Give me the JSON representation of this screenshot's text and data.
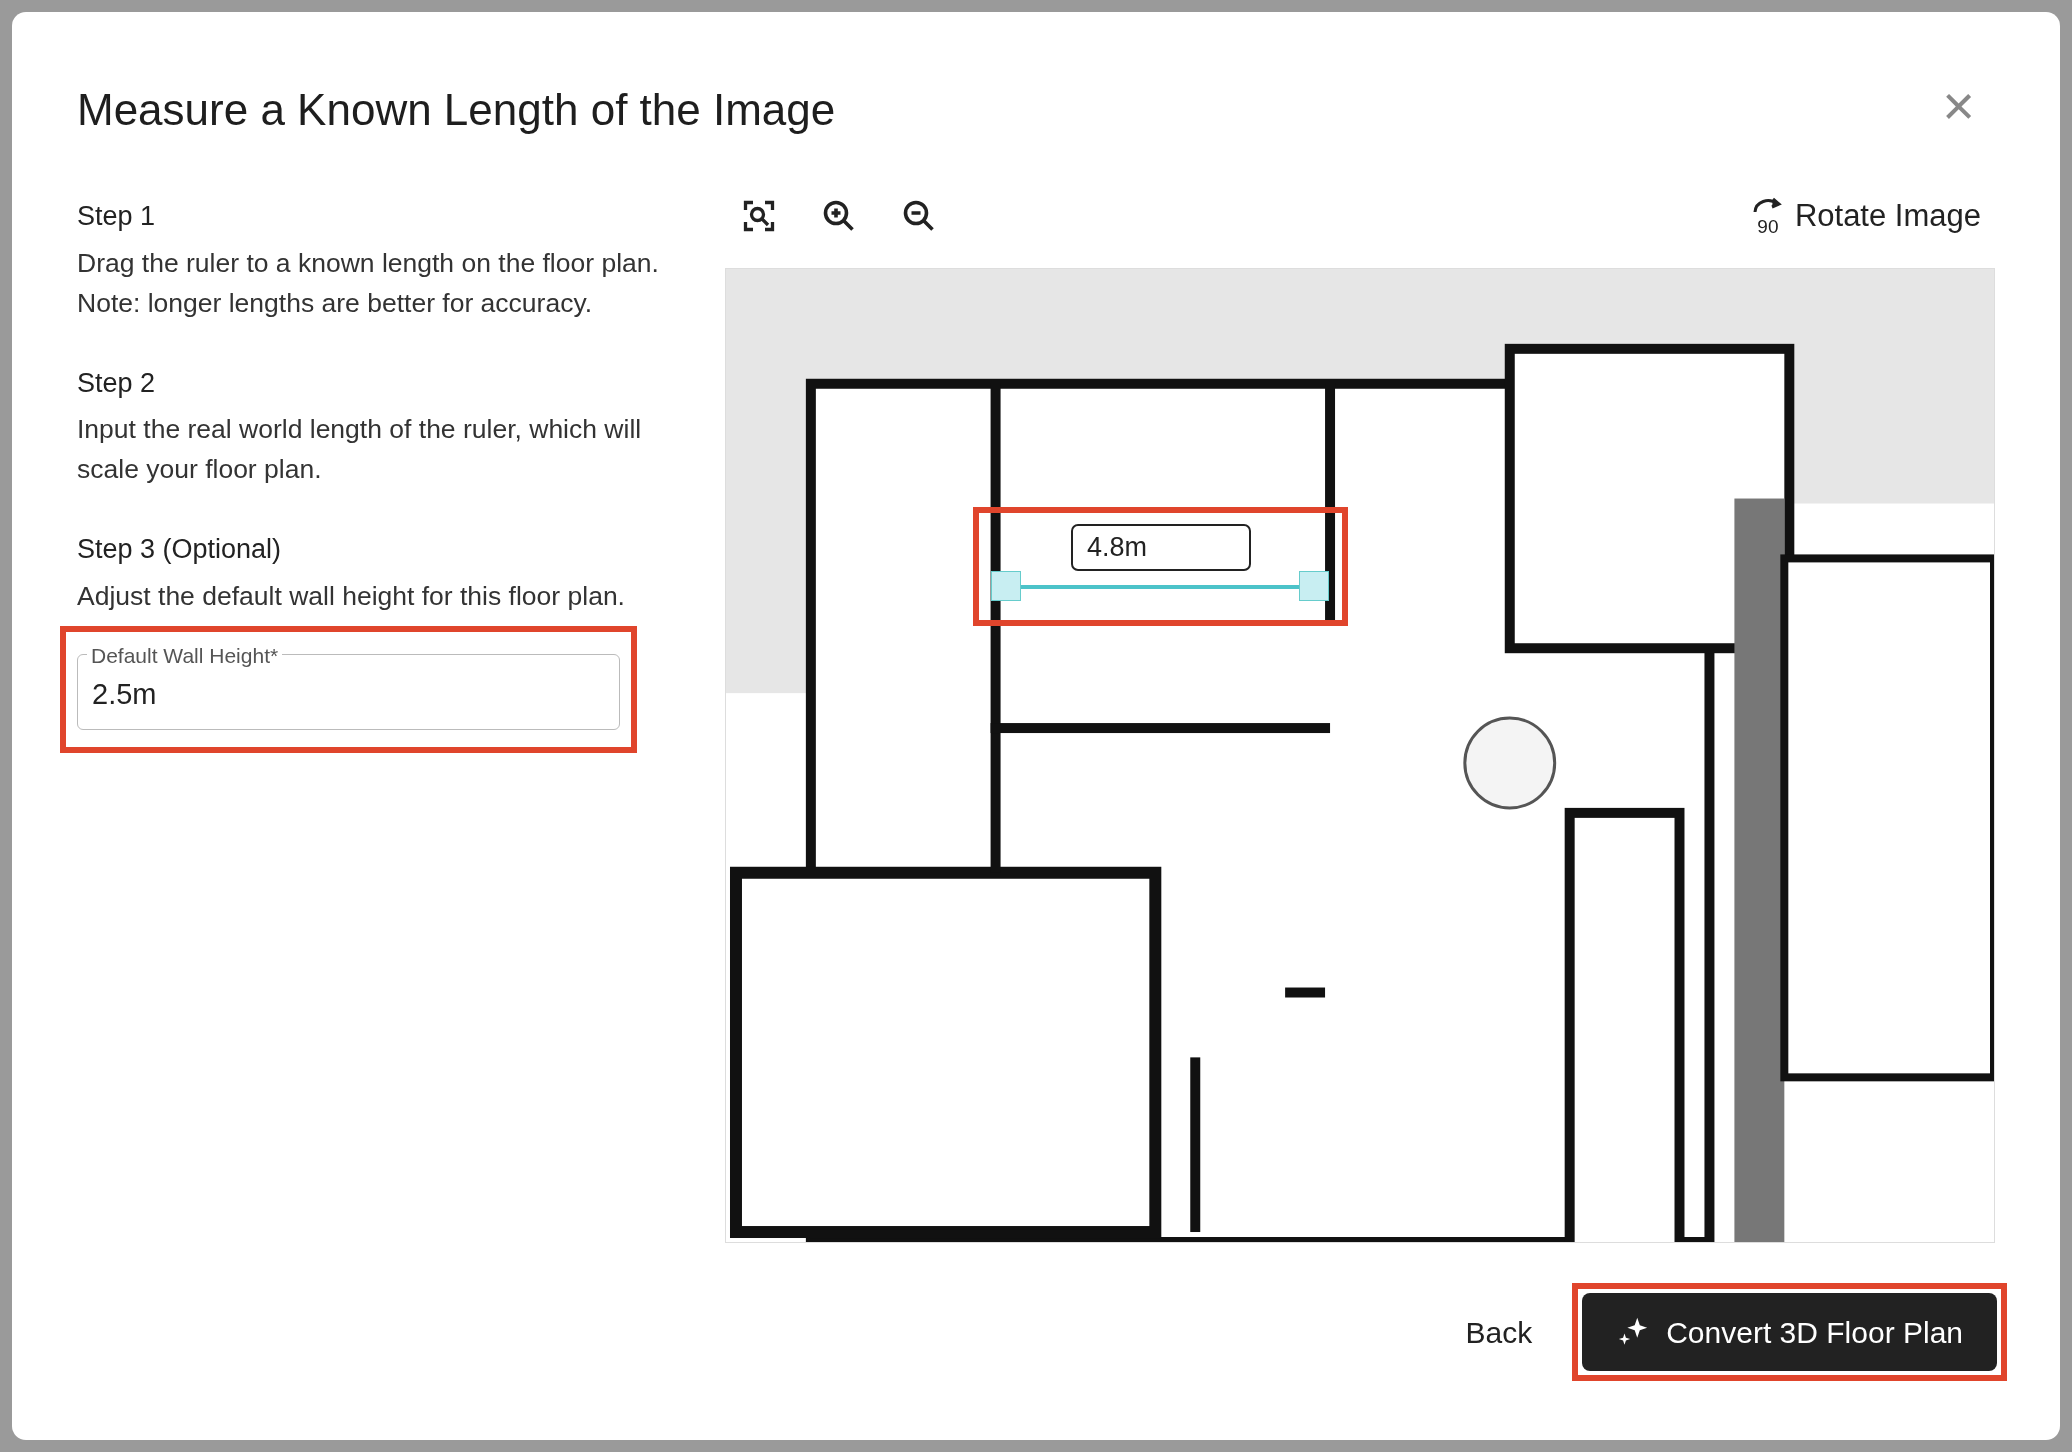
{
  "dialog": {
    "title": "Measure a Known Length of the Image",
    "close": "×",
    "steps": [
      {
        "heading": "Step 1",
        "text": "Drag the ruler to a known length on the floor plan. Note: longer lengths are better for accuracy."
      },
      {
        "heading": "Step 2",
        "text": "Input the real world length of the ruler, which will scale your floor plan."
      },
      {
        "heading": "Step 3 (Optional)",
        "text": "Adjust the default wall height for this floor plan."
      }
    ],
    "wall_height_field": {
      "label": "Default Wall Height*",
      "value": "2.5m"
    },
    "toolbar": {
      "rotate_badge": "90",
      "rotate_label": "Rotate Image"
    },
    "ruler": {
      "length": "4.8m"
    },
    "back_label": "Back",
    "convert_label": "Convert 3D Floor Plan"
  }
}
